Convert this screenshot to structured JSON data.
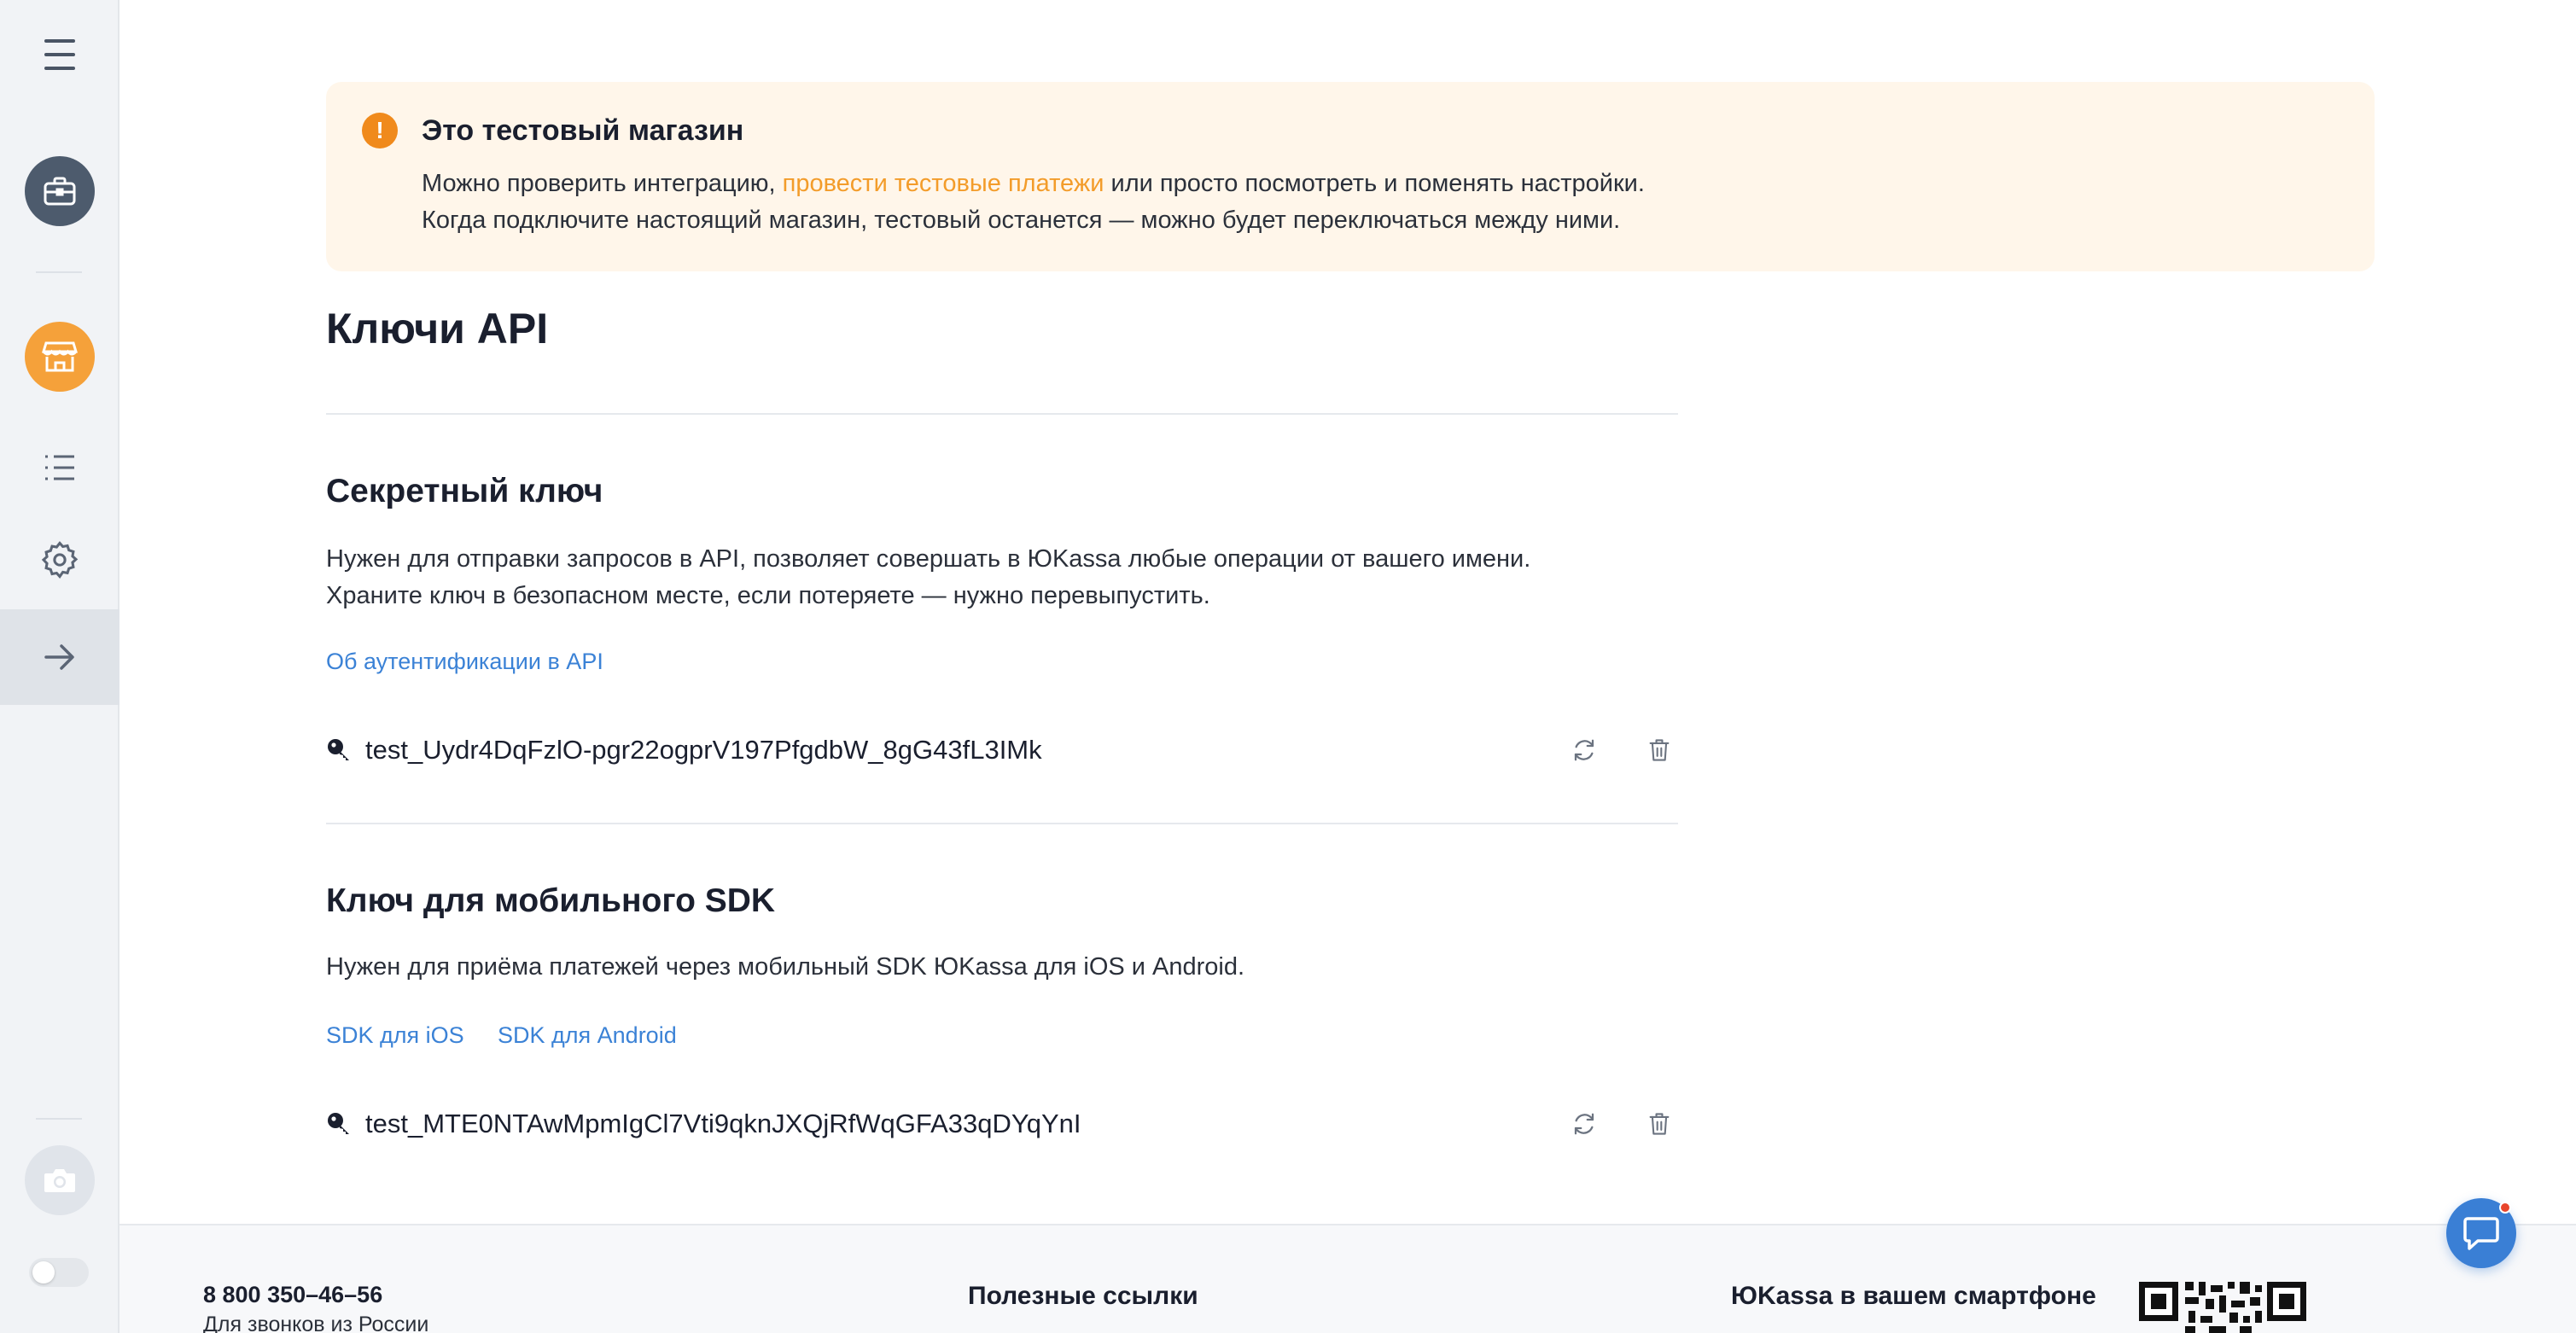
{
  "sidebar": {
    "icons": [
      "menu-icon",
      "briefcase-icon",
      "store-icon",
      "list-icon",
      "gear-icon",
      "arrow-right-icon",
      "camera-icon"
    ],
    "accent_color": "#f5a13a"
  },
  "notice": {
    "title": "Это тестовый магазин",
    "line1_before": "Можно проверить интеграцию, ",
    "line1_link": "провести тестовые платежи",
    "line1_after": " или просто посмотреть и поменять настройки.",
    "line2": "Когда подключите настоящий магазин, тестовый останется — можно будет переключаться между ними.",
    "icon": "exclamation-icon"
  },
  "page": {
    "title": "Ключи API"
  },
  "secret_key": {
    "title": "Секретный ключ",
    "desc_line1": "Нужен для отправки запросов в API, позволяет совершать в ЮKassa любые операции от вашего имени.",
    "desc_line2": "Храните ключ в безопасном месте, если потеряете — нужно перевыпустить.",
    "link": "Об аутентификации в API",
    "value": "test_Uydr4DqFzlO-pgr22ogprV197PfgdbW_8gG43fL3IMk"
  },
  "sdk_key": {
    "title": "Ключ для мобильного SDK",
    "desc": "Нужен для приёма платежей через мобильный SDK ЮKassa для iOS и Android.",
    "link_ios": "SDK для iOS",
    "link_android": "SDK для Android",
    "value": "test_MTE0NTAwMpmIgCl7Vti9qknJXQjRfWqGFA33qDYqYnI"
  },
  "footer": {
    "phone": "8 800 350–46–56",
    "phone_sub": "Для звонков из России",
    "useful_links": "Полезные ссылки",
    "app_title": "ЮKassa в вашем смартфоне"
  },
  "colors": {
    "link": "#3b82d6",
    "notice_bg": "#fff6ea",
    "notice_link": "#f39c2a",
    "chat": "#3a7fd5"
  }
}
